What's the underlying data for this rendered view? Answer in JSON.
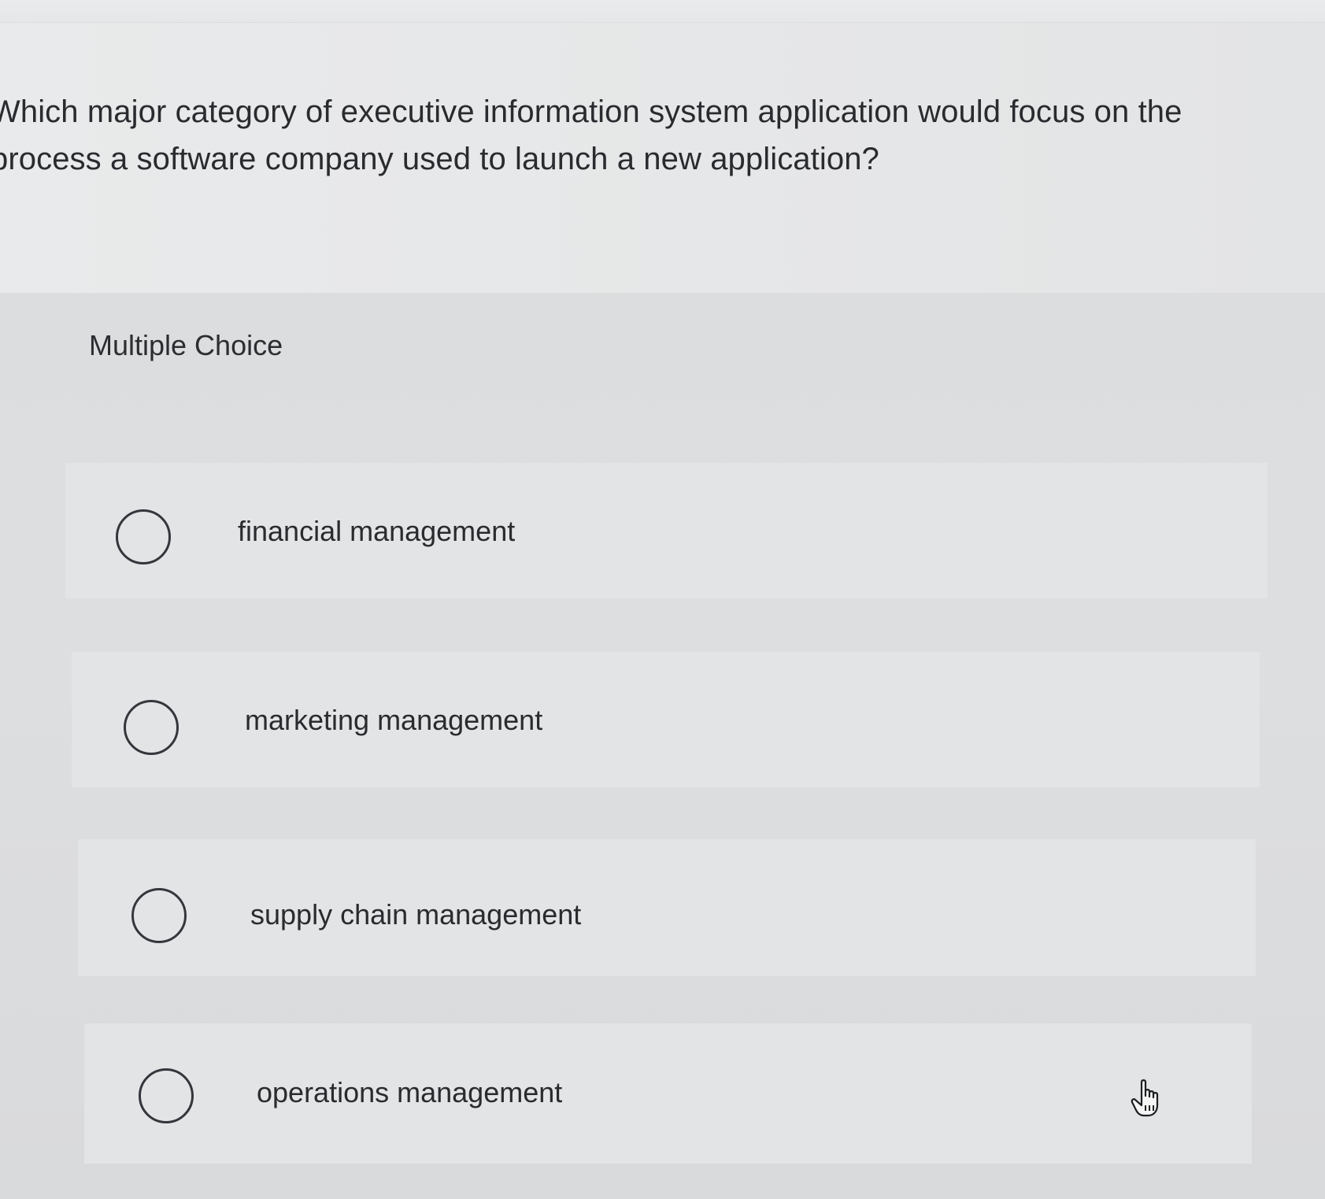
{
  "question": {
    "line1": "Which major category of executive information system application would focus on the",
    "line2": "process a software company used to launch a new application?"
  },
  "section_label": "Multiple Choice",
  "choices": [
    {
      "label": "financial management",
      "selected": false
    },
    {
      "label": "marketing management",
      "selected": false
    },
    {
      "label": "supply chain management",
      "selected": false
    },
    {
      "label": "operations management",
      "selected": false
    }
  ],
  "cursor": {
    "icon": "hand-pointer-icon"
  }
}
